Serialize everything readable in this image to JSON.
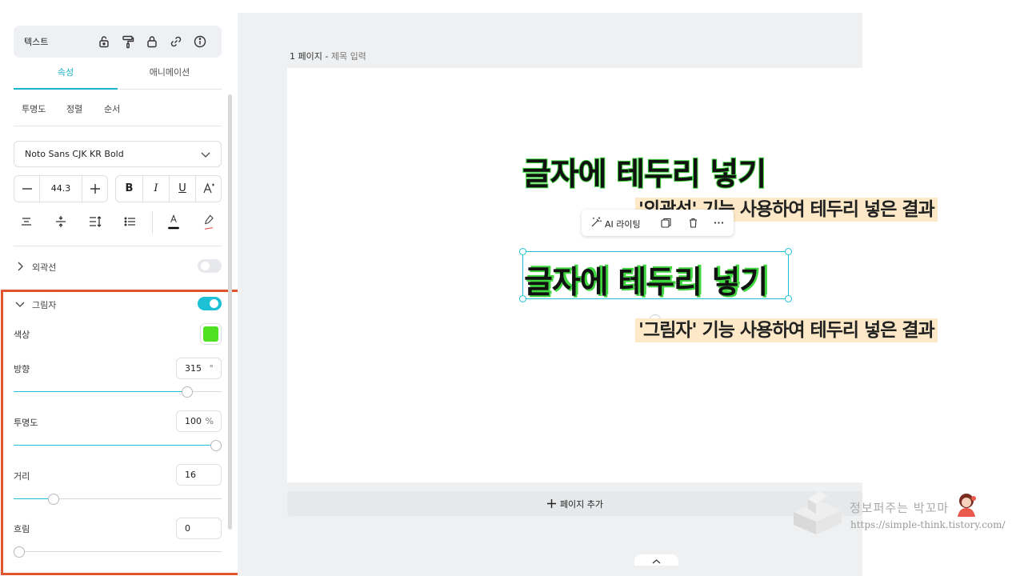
{
  "panel": {
    "title": "텍스트",
    "header_icons": [
      "unlock-icon",
      "paint-roller-icon",
      "lock-icon",
      "link-icon",
      "info-icon"
    ],
    "tabs": [
      {
        "label": "속성",
        "active": true
      },
      {
        "label": "애니메이션",
        "active": false
      }
    ],
    "subtabs": [
      "투명도",
      "정렬",
      "순서"
    ],
    "font": "Noto Sans CJK KR Bold",
    "font_size": "44.3",
    "style_buttons": [
      "B",
      "I",
      "U"
    ],
    "tool_icons": [
      "align-center-icon",
      "vertical-align-icon",
      "line-spacing-icon",
      "list-icon",
      "text-color-icon",
      "highlight-icon"
    ],
    "text_color": "#000000",
    "outline": {
      "label": "외곽선",
      "enabled": false
    },
    "shadow": {
      "label": "그림자",
      "enabled": true,
      "color_label": "색상",
      "color": "#4fe021",
      "direction": {
        "label": "방향",
        "value": "315",
        "unit": "°",
        "fraction": 0.855
      },
      "opacity": {
        "label": "투명도",
        "value": "100",
        "unit": "%",
        "fraction": 1.0
      },
      "distance": {
        "label": "거리",
        "value": "16",
        "fraction": 0.175
      },
      "blur": {
        "label": "흐림",
        "value": "0",
        "fraction": 0.0
      }
    }
  },
  "canvas": {
    "page_label": "1 페이지 -",
    "page_title_placeholder": "제목 입력",
    "headline_1": "글자에 테두리 넣기",
    "caption_1": "'외곽선' 기능 사용하여 테두리 넣은 결과",
    "headline_2": "글자에 테두리 넣기",
    "caption_2": "'그림자' 기능 사용하여 테두리 넣은 결과",
    "ai_button": "AI 라이팅",
    "add_page": "페이지 추가",
    "outline_color": "#3fd63f",
    "selection_color": "#1ec0d6"
  },
  "watermark": {
    "name": "정보퍼주는 박꼬마",
    "url": "https://simple-think.tistory.com/"
  }
}
